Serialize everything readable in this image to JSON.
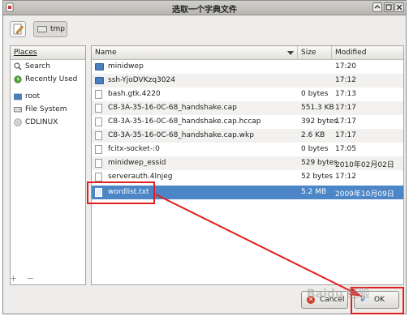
{
  "window": {
    "title": "选取一个字典文件"
  },
  "pathbar": {
    "current_folder": "tmp"
  },
  "places": {
    "header": "Places",
    "items": [
      {
        "label": "Search",
        "icon": "search-icon"
      },
      {
        "label": "Recently Used",
        "icon": "clock-icon"
      },
      {
        "label": "root",
        "icon": "home-folder-icon"
      },
      {
        "label": "File System",
        "icon": "harddisk-icon"
      },
      {
        "label": "CDLINUX",
        "icon": "cdrom-icon"
      }
    ],
    "add_label": "+",
    "remove_label": "−"
  },
  "files": {
    "columns": {
      "name": "Name",
      "size": "Size",
      "modified": "Modified"
    },
    "rows": [
      {
        "name": "minidwep",
        "size": "",
        "modified": "17:20",
        "type": "folder"
      },
      {
        "name": "ssh-YjoDVKzq3024",
        "size": "",
        "modified": "17:12",
        "type": "folder"
      },
      {
        "name": "bash.gtk.4220",
        "size": "0 bytes",
        "modified": "17:13",
        "type": "file"
      },
      {
        "name": "C8-3A-35-16-0C-68_handshake.cap",
        "size": "551.3 KB",
        "modified": "17:17",
        "type": "file"
      },
      {
        "name": "C8-3A-35-16-0C-68_handshake.cap.hccap",
        "size": "392 bytes",
        "modified": "17:17",
        "type": "file"
      },
      {
        "name": "C8-3A-35-16-0C-68_handshake.cap.wkp",
        "size": "2.6 KB",
        "modified": "17:17",
        "type": "file"
      },
      {
        "name": "fcitx-socket-:0",
        "size": "0 bytes",
        "modified": "17:05",
        "type": "file"
      },
      {
        "name": "minidwep_essid",
        "size": "529 bytes",
        "modified": "2010年02月02日",
        "type": "file"
      },
      {
        "name": "serverauth.4lnjeg",
        "size": "52 bytes",
        "modified": "17:12",
        "type": "file"
      },
      {
        "name": "wordlist.txt",
        "size": "5.2 MB",
        "modified": "2009年10月09日",
        "type": "file",
        "selected": true
      }
    ]
  },
  "buttons": {
    "cancel": "Cancel",
    "ok": "OK"
  },
  "watermark": "Baidu 经验",
  "colors": {
    "selection": "#4c86c6",
    "annotation": "#e02020",
    "folder": "#4a7fbe"
  }
}
